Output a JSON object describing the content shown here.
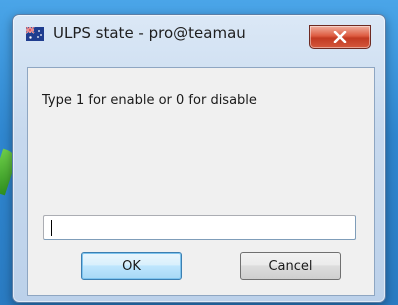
{
  "window": {
    "title": "ULPS state - pro@teamau",
    "icon": "flag-icon",
    "close_label": "close"
  },
  "dialog": {
    "prompt": "Type 1 for enable or 0 for disable",
    "input_value": "",
    "ok_label": "OK",
    "cancel_label": "Cancel"
  },
  "colors": {
    "close_button": "#c23a22",
    "default_button_border": "#3c7fb1"
  }
}
